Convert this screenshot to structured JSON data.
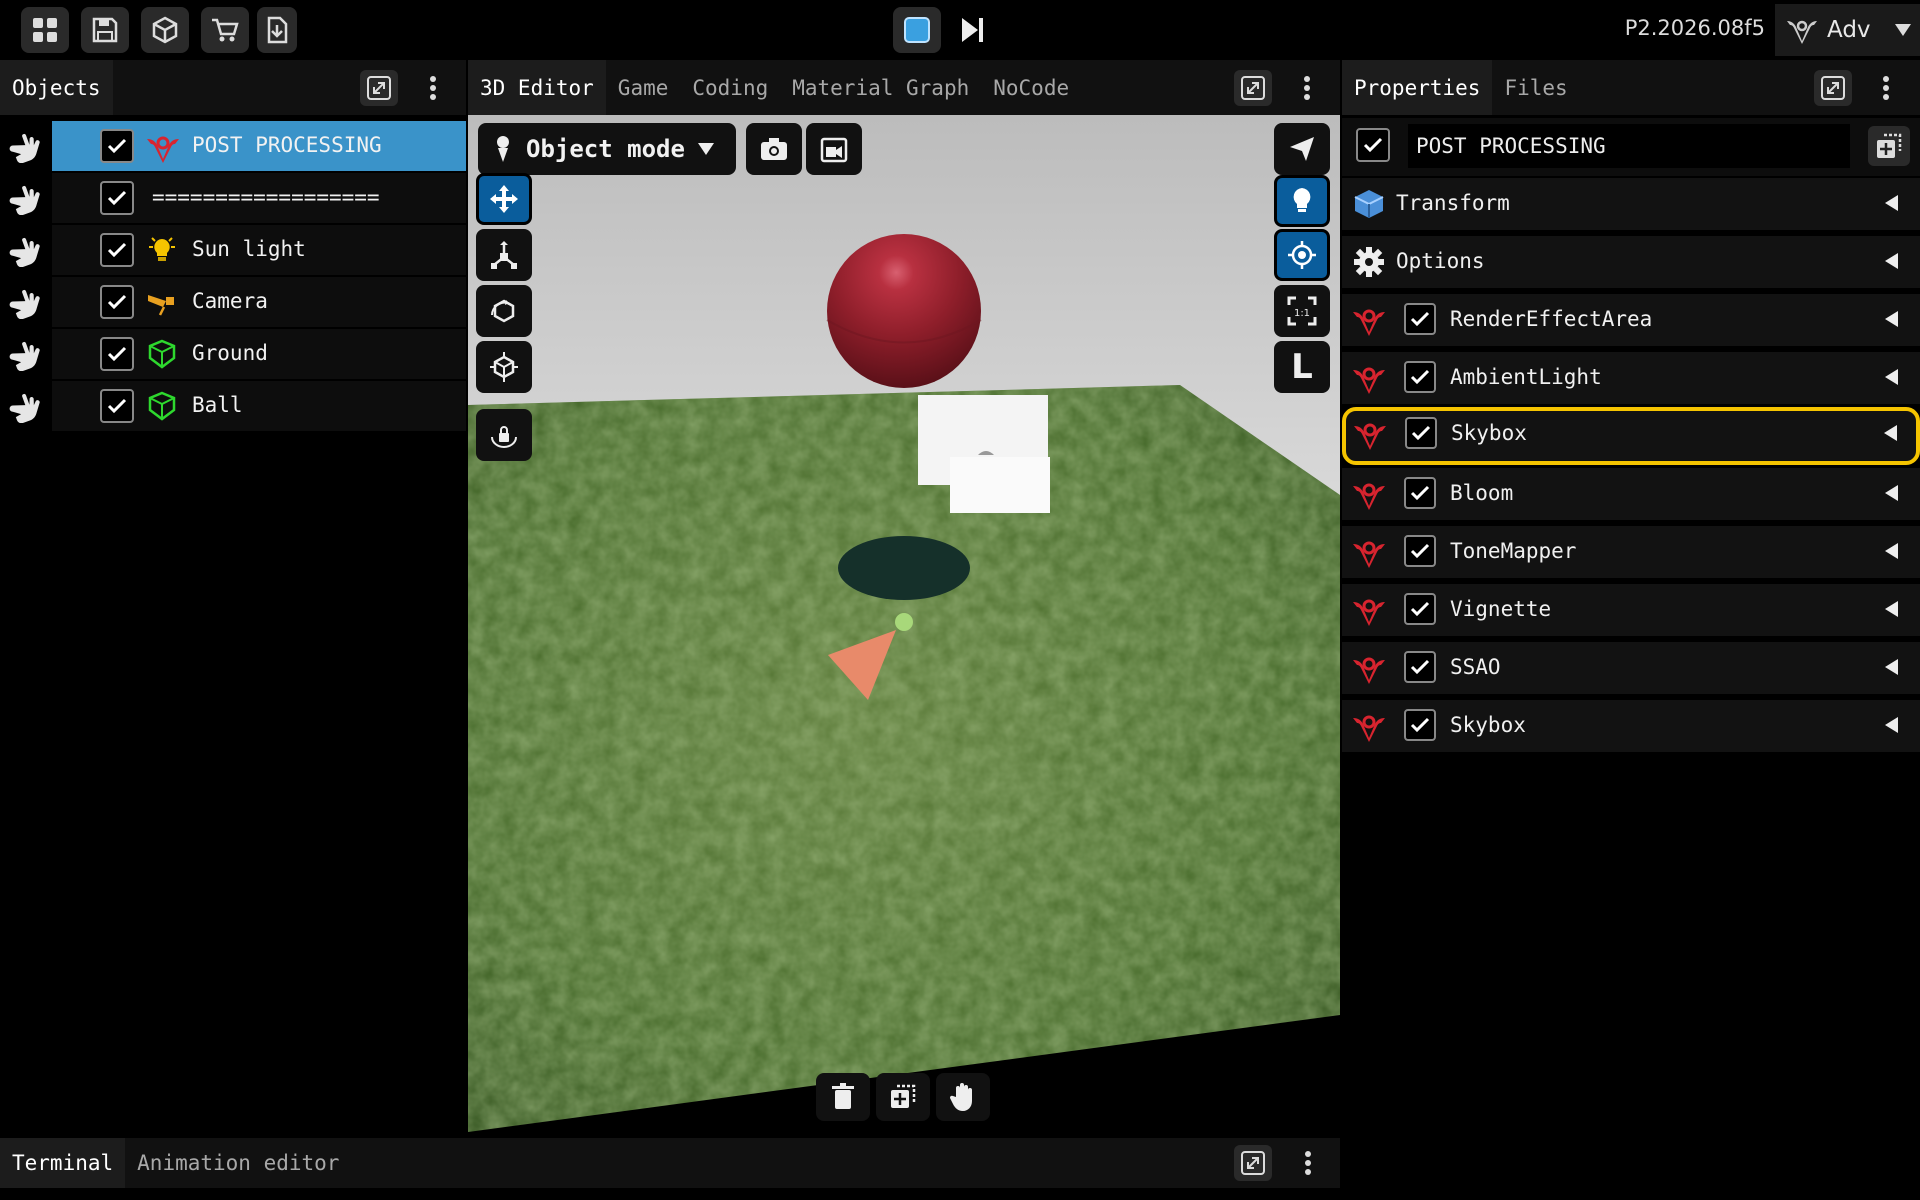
{
  "topbar": {
    "icons": [
      "grid-icon",
      "save-icon",
      "cube-icon",
      "cart-icon",
      "download-icon"
    ],
    "version": "P2.2026.08f5",
    "adv_label": "Adv"
  },
  "objects": {
    "tab_label": "Objects",
    "rows": [
      {
        "label": "POST PROCESSING",
        "icon": "post-processing-icon",
        "selected": true
      },
      {
        "label": "==================",
        "icon": "none",
        "selected": false
      },
      {
        "label": "Sun light",
        "icon": "bulb-icon",
        "selected": false
      },
      {
        "label": "Camera",
        "icon": "camera-icon",
        "selected": false
      },
      {
        "label": "Ground",
        "icon": "mesh-icon",
        "selected": false
      },
      {
        "label": "Ball",
        "icon": "mesh-icon",
        "selected": false
      }
    ]
  },
  "editor": {
    "tabs": [
      "3D Editor",
      "Game",
      "Coding",
      "Material Graph",
      "NoCode"
    ],
    "active_tab": "3D Editor",
    "mode_label": "Object mode",
    "right_l_label": "L"
  },
  "bottom": {
    "tabs": [
      "Terminal",
      "Animation editor"
    ],
    "active_tab": "Terminal"
  },
  "properties": {
    "tabs": [
      "Properties",
      "Files"
    ],
    "active_tab": "Properties",
    "object_name": "POST PROCESSING",
    "sections": [
      {
        "label": "Transform",
        "icon": "transform-cube-icon"
      },
      {
        "label": "Options",
        "icon": "gear-icon"
      }
    ],
    "components": [
      {
        "label": "RenderEffectArea",
        "highlight": false
      },
      {
        "label": "AmbientLight",
        "highlight": false
      },
      {
        "label": "Skybox",
        "highlight": true
      },
      {
        "label": "Bloom",
        "highlight": false
      },
      {
        "label": "ToneMapper",
        "highlight": false
      },
      {
        "label": "Vignette",
        "highlight": false
      },
      {
        "label": "SSAO",
        "highlight": false
      },
      {
        "label": "Skybox",
        "highlight": false
      }
    ]
  },
  "colors": {
    "selection": "#3a93c9",
    "highlight": "#f5c400",
    "accent_blue": "#0a5d9c",
    "logo_red": "#d8242f"
  }
}
